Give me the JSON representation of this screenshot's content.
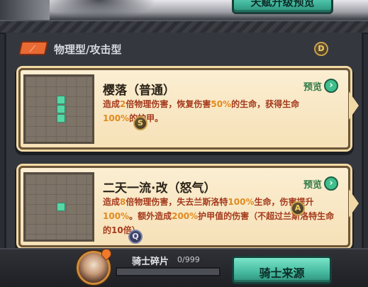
{
  "top": {
    "button_label": "天赋升级预览"
  },
  "section": {
    "title": "物理型/攻击型"
  },
  "badges": {
    "d": "D",
    "s": "S",
    "a": "A",
    "q": "Q"
  },
  "skills": [
    {
      "name": "樱落（普通）",
      "preview_label": "预览",
      "preview_icon": "›",
      "desc_parts": [
        "造成",
        "2",
        "倍物理伤害，恢复伤害",
        "50%",
        "的生命，获得生命",
        "100%",
        "的护甲。"
      ]
    },
    {
      "name": "二天一流·改（怒气）",
      "preview_label": "预览",
      "preview_icon": "›",
      "desc_parts": [
        "造成",
        "8",
        "倍物理伤害，失去兰斯洛特",
        "100%",
        "生命，伤害提升",
        "100%",
        "。额外造成",
        "200%",
        "护甲值的伤害（不超过兰斯洛特生命的10倍）。"
      ]
    }
  ],
  "bottom": {
    "fragment_label": "骑士碎片",
    "fragment_count": "0/999",
    "fragment_progress": 0,
    "source_button": "骑士来源"
  },
  "colors": {
    "accent_green": "#45b99f",
    "text_red": "#a4391c",
    "highlight_orange": "#e28a1e"
  },
  "icons": {
    "category": "sword-icon",
    "preview": "chevron-right-icon"
  }
}
